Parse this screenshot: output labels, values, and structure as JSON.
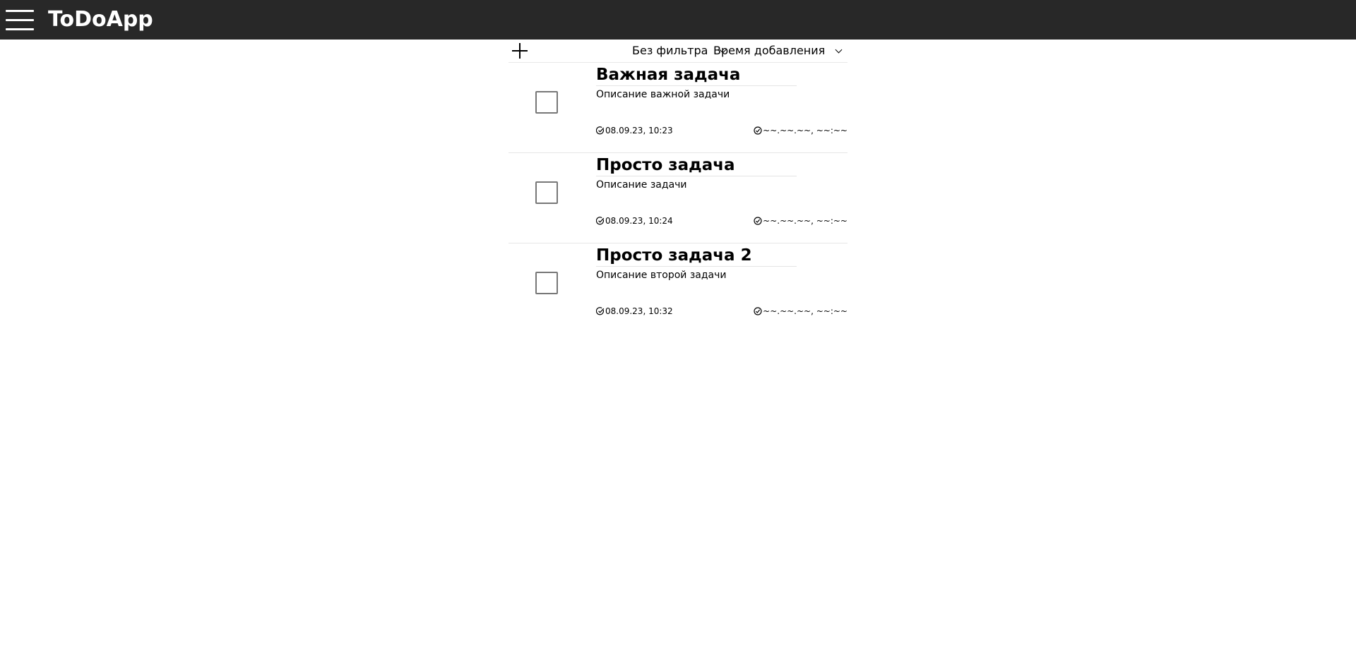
{
  "app": {
    "title": "ToDoApp"
  },
  "toolbar": {
    "filter_value": "Без фильтра",
    "sort_value": "Время добавления"
  },
  "tasks": [
    {
      "title": "Важная задача",
      "description": "Описание важной задачи",
      "created": "08.09.23, 10:23",
      "completed": "~~.~~.~~, ~~:~~",
      "checked": false
    },
    {
      "title": "Просто задача",
      "description": "Описание задачи",
      "created": "08.09.23, 10:24",
      "completed": "~~.~~.~~, ~~:~~",
      "checked": false
    },
    {
      "title": "Просто задача 2",
      "description": "Описание второй задачи",
      "created": "08.09.23, 10:32",
      "completed": "~~.~~.~~, ~~:~~",
      "checked": false
    }
  ],
  "icons": {
    "menu": "hamburger-menu-icon",
    "add": "plus-icon",
    "dropdown": "chevron-down-icon",
    "created": "circle-check-icon",
    "completed": "circle-check-icon"
  }
}
